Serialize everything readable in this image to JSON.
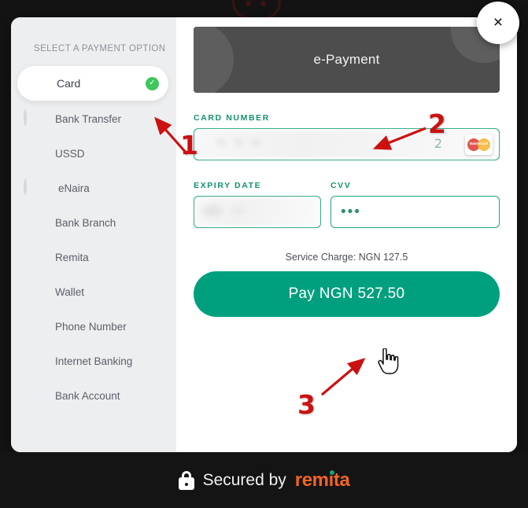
{
  "window": {
    "background": "#141414"
  },
  "close_button": {
    "label": "×",
    "icon": "close-icon"
  },
  "top_logo": {
    "icon": "partial-brand-logo"
  },
  "sidebar": {
    "title": "SELECT A PAYMENT OPTION",
    "items": [
      {
        "label": "Card",
        "icon": "credit-card-icon",
        "selected": true,
        "check": "✓"
      },
      {
        "label": "Bank Transfer",
        "icon": "bank-transfer-icon",
        "selected": false
      },
      {
        "label": "USSD",
        "icon": "ussd-icon",
        "selected": false
      },
      {
        "label": "eNaira",
        "icon": "enaira-icon",
        "selected": false
      },
      {
        "label": "Bank Branch",
        "icon": "bank-branch-icon",
        "selected": false
      },
      {
        "label": "Remita",
        "icon": "remita-icon",
        "selected": false
      },
      {
        "label": "Wallet",
        "icon": "wallet-icon",
        "selected": false
      },
      {
        "label": "Phone Number",
        "icon": "phone-icon",
        "selected": false
      },
      {
        "label": "Internet Banking",
        "icon": "internet-banking-icon",
        "selected": false
      },
      {
        "label": "Bank Account",
        "icon": "bank-account-icon",
        "selected": false
      }
    ]
  },
  "banner": {
    "title": "e-Payment",
    "background": "#4d4d4d"
  },
  "form": {
    "card_number": {
      "label": "CARD NUMBER",
      "value": "2",
      "redacted": true,
      "brand_icon": "mastercard-icon",
      "brand_name": "MasterCard"
    },
    "expiry": {
      "label": "EXPIRY DATE",
      "value": "",
      "redacted": true
    },
    "cvv": {
      "label": "CVV",
      "value": "•••"
    }
  },
  "service_charge": "Service Charge: NGN 127.5",
  "pay_button": {
    "label": "Pay NGN 527.50",
    "color": "#00a07e"
  },
  "footer": {
    "secured_text": "Secured by",
    "brand": "remita",
    "lock_icon": "lock-icon",
    "brand_color": "#f26522",
    "accent_color": "#0ea47e"
  },
  "annotations": {
    "step1": "1",
    "step2": "2",
    "step3": "3",
    "color": "#cc1111"
  }
}
